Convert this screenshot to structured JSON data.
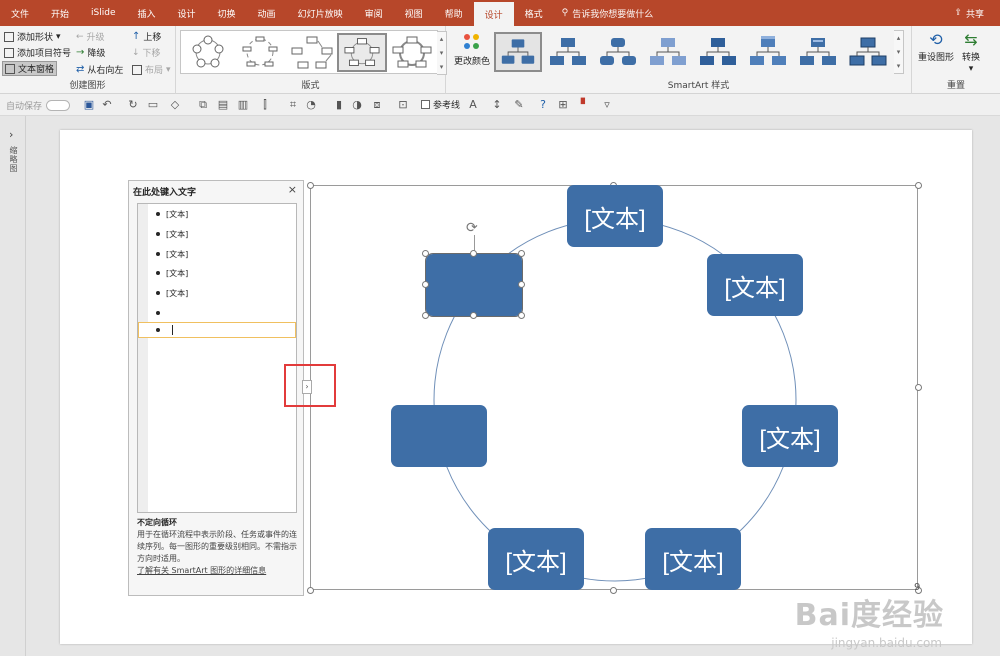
{
  "tabs": [
    "文件",
    "开始",
    "iSlide",
    "插入",
    "设计",
    "切换",
    "动画",
    "幻灯片放映",
    "审阅",
    "视图",
    "帮助",
    "设计",
    "格式"
  ],
  "active_tab_index": 11,
  "search_hint": "告诉我你想要做什么",
  "share_label": "共享",
  "ribbon": {
    "create_graphic": {
      "label": "创建图形",
      "add_shape": "添加形状",
      "add_bullet": "添加项目符号",
      "text_pane": "文本窗格",
      "promote": "升级",
      "demote": "降级",
      "rtl": "从右向左",
      "move_up": "上移",
      "move_down": "下移",
      "layout_btn": "布局"
    },
    "layouts_label": "版式",
    "change_colors": "更改颜色",
    "styles_label": "SmartArt 样式",
    "reset": {
      "label": "重置",
      "reset_graphic": "重设图形",
      "convert": "转换"
    }
  },
  "qat": {
    "autosave": "自动保存",
    "gridlines": "参考线"
  },
  "left_pane_label": "缩略图",
  "text_pane": {
    "title": "在此处键入文字",
    "items": [
      "[文本]",
      "[文本]",
      "[文本]",
      "[文本]",
      "[文本]",
      "",
      ""
    ],
    "desc_title": "不定向循环",
    "desc_body": "用于在循环流程中表示阶段、任务或事件的连续序列。每一图形的重要级别相同。不需指示方向时适用。",
    "desc_link": "了解有关 SmartArt 图形的详细信息"
  },
  "nodes": [
    "[文本]",
    "",
    "[文本]",
    "[文本]",
    "[文本]",
    "[文本]",
    ""
  ],
  "node_color": "#3e6ea6",
  "accent_color": "#b7472a",
  "highlight_color": "#e23b3b",
  "watermark": "Bai度经验",
  "watermark_sub": "jingyan.baidu.com",
  "page_number": "9"
}
